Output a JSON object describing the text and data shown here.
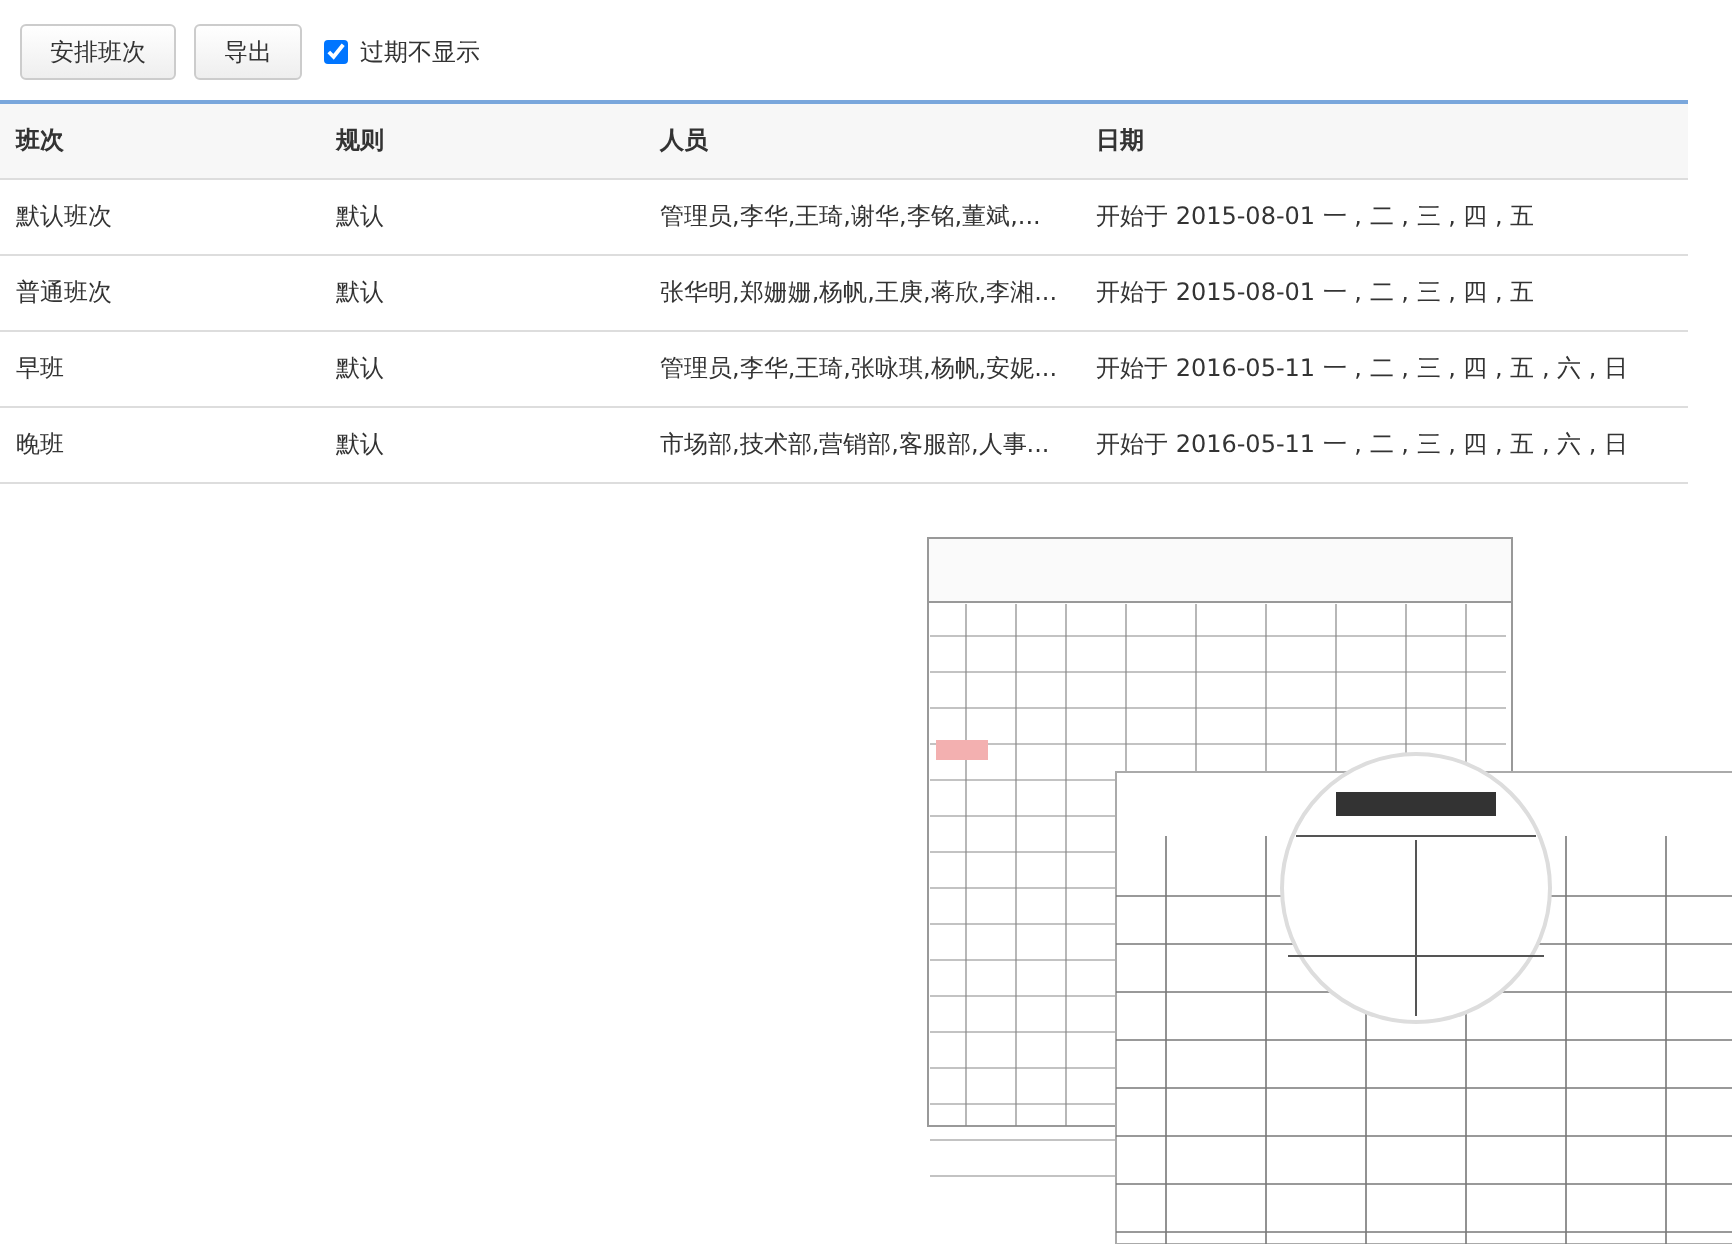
{
  "toolbar": {
    "buttons": [
      "安排班次",
      "导出"
    ],
    "hide_expired": {
      "label": "过期不显示",
      "checked": true
    }
  },
  "table": {
    "columns": [
      "班次",
      "规则",
      "人员",
      "日期"
    ],
    "rows": [
      [
        "默认班次",
        "默认",
        "管理员,李华,王琦,谢华,李铭,董斌,...",
        "开始于 2015-08-01 一 , 二 , 三 , 四 , 五"
      ],
      [
        "普通班次",
        "默认",
        "张华明,郑姗姗,杨帆,王庚,蒋欣,李湘...",
        "开始于 2015-08-01 一 , 二 , 三 , 四 , 五"
      ],
      [
        "早班",
        "默认",
        "管理员,李华,王琦,张咏琪,杨帆,安妮...",
        "开始于 2016-05-11 一 , 二 , 三 , 四 , 五 , 六 , 日"
      ],
      [
        "晚班",
        "默认",
        "市场部,技术部,营销部,客服部,人事...",
        "开始于 2016-05-11 一 , 二 , 三 , 四 , 五 , 六 , 日"
      ]
    ]
  }
}
